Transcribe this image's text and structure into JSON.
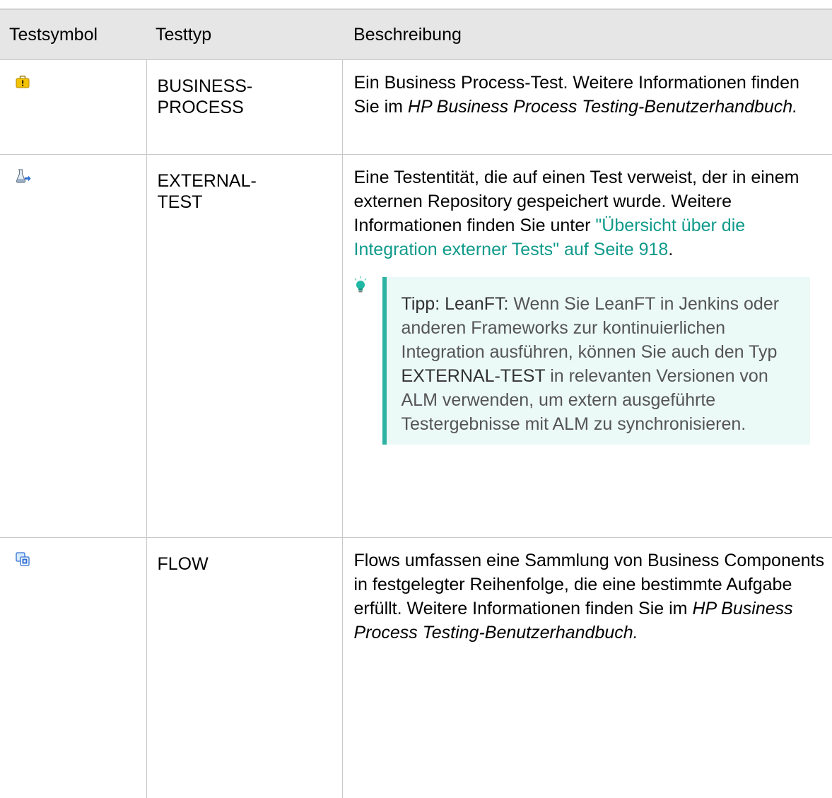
{
  "headers": {
    "col_icon": "Testsymbol",
    "col_type": "Testtyp",
    "col_desc": "Beschreibung"
  },
  "rows": [
    {
      "icon": "business-process-icon",
      "type_line1": "BUSINESS-",
      "type_line2": "PROCESS",
      "desc_text": "Ein Business Process-Test. Weitere Informationen finden Sie im ",
      "desc_italic": "HP Business Process Testing-Benutzerhandbuch."
    },
    {
      "icon": "external-test-icon",
      "type_line1": "EXTERNAL-",
      "type_line2": "TEST",
      "desc_text": "Eine Testentität, die auf einen Test verweist, der in einem externen Repository gespeichert wurde. Weitere Informationen finden Sie unter ",
      "desc_link": "\"Übersicht über die Integration externer Tests\" auf Seite 918",
      "desc_after": ".",
      "tip": {
        "icon": "lightbulb-icon",
        "label": "Tipp: LeanFT:",
        "text_before": " Wenn Sie LeanFT in Jenkins oder anderen Frameworks zur kontinuierlichen Integration ausführen, können Sie auch den Typ ",
        "highlight": "EXTERNAL-TEST",
        "text_after": " in relevanten Versionen von ALM verwenden, um extern ausgeführte Testergebnisse mit ALM zu synchronisieren."
      }
    },
    {
      "icon": "flow-icon",
      "type_line1": "FLOW",
      "desc_text": "Flows umfassen eine Sammlung von Business Components in festgelegter Reihenfolge, die eine bestimmte Aufgabe erfüllt. Weitere Informationen finden Sie im ",
      "desc_italic": "HP Business Process Testing-Benutzerhandbuch."
    }
  ],
  "colors": {
    "link": "#0f9a8b",
    "tip_border": "#2eb3a2",
    "tip_background": "#ebf9f7",
    "header_background": "#e6e6e6"
  }
}
